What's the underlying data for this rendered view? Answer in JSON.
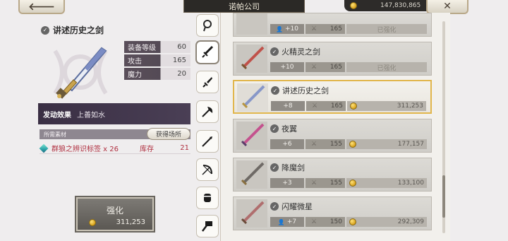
{
  "topbar": {
    "back_glyph": "🡐",
    "title": "诺帕公司",
    "gold": "147,830,865",
    "close_glyph": "✕"
  },
  "item": {
    "name": "讲述历史之剑",
    "stats": [
      {
        "label": "装备等级",
        "value": "60"
      },
      {
        "label": "攻击",
        "value": "165"
      },
      {
        "label": "魔力",
        "value": "20"
      }
    ],
    "effect_label": "发动效果",
    "effect_value": "上善如水",
    "materials_header": "所需素材",
    "obtain_button": "获得场所",
    "material_name": "群狼之辨识标签 x 26",
    "stock_label": "库存",
    "stock_value": "21"
  },
  "upgrade": {
    "label": "强化",
    "cost": "311,253"
  },
  "tabs": [
    {
      "name": "tab-accessory",
      "icon": "ring"
    },
    {
      "name": "tab-sword",
      "icon": "sword"
    },
    {
      "name": "tab-dagger",
      "icon": "dagger"
    },
    {
      "name": "tab-axe",
      "icon": "axe"
    },
    {
      "name": "tab-spear",
      "icon": "spear"
    },
    {
      "name": "tab-bow",
      "icon": "bow"
    },
    {
      "name": "tab-gauntlet",
      "icon": "gauntlet"
    },
    {
      "name": "tab-hammer",
      "icon": "hammer"
    }
  ],
  "list": [
    {
      "name": "",
      "level": "+10",
      "attack": "165",
      "cost": "已强化",
      "has_user": true,
      "enhanced": true
    },
    {
      "name": "火精灵之剑",
      "level": "+10",
      "attack": "165",
      "cost": "已强化",
      "has_user": false,
      "enhanced": true
    },
    {
      "name": "讲述历史之剑",
      "level": "+8",
      "attack": "165",
      "cost": "311,253",
      "has_user": false,
      "enhanced": false
    },
    {
      "name": "夜翼",
      "level": "+6",
      "attack": "155",
      "cost": "177,157",
      "has_user": false,
      "enhanced": false
    },
    {
      "name": "降魔剑",
      "level": "+3",
      "attack": "155",
      "cost": "133,100",
      "has_user": false,
      "enhanced": false
    },
    {
      "name": "闪耀微星",
      "level": "+7",
      "attack": "150",
      "cost": "292,309",
      "has_user": true,
      "enhanced": false
    }
  ],
  "colors": {
    "accent_gold": "#e1b64c",
    "panel_purple": "#4a3f55",
    "material_red": "#b03040"
  }
}
